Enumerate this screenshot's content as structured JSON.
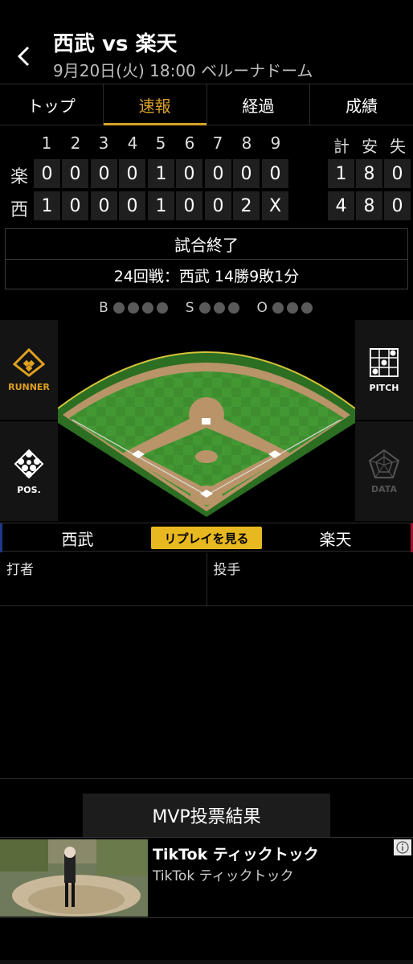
{
  "header": {
    "title": "西武 vs 楽天",
    "subtitle": "9月20日(火) 18:00 ベルーナドーム"
  },
  "tabs": [
    {
      "label": "トップ"
    },
    {
      "label": "速報",
      "active": true
    },
    {
      "label": "経過"
    },
    {
      "label": "成績"
    }
  ],
  "scoreboard": {
    "innings": [
      "1",
      "2",
      "3",
      "4",
      "5",
      "6",
      "7",
      "8",
      "9"
    ],
    "totals_headers": [
      "計",
      "安",
      "失"
    ],
    "rows": [
      {
        "team": "楽",
        "scores": [
          "0",
          "0",
          "0",
          "0",
          "1",
          "0",
          "0",
          "0",
          "0"
        ],
        "totals": [
          "1",
          "8",
          "0"
        ]
      },
      {
        "team": "西",
        "scores": [
          "1",
          "0",
          "0",
          "0",
          "1",
          "0",
          "0",
          "2",
          "X"
        ],
        "totals": [
          "4",
          "8",
          "0"
        ]
      }
    ]
  },
  "status": {
    "state": "試合終了",
    "record": "24回戦：西武 14勝9敗1分"
  },
  "bso": {
    "b_label": "B",
    "s_label": "S",
    "o_label": "O",
    "balls": 0,
    "strikes": 0,
    "outs": 0
  },
  "field_buttons": {
    "runner": "RUNNER",
    "pitch": "PITCH",
    "pos": "POS.",
    "data": "DATA"
  },
  "colors": {
    "accent": "#d8a12a",
    "replay_bg": "#e8b820",
    "home_bar": "#1a3a8a",
    "away_bar": "#a01030",
    "grass": "#3d8c2f",
    "dirt": "#b89468"
  },
  "matchup": {
    "left_team": "西武",
    "right_team": "楽天",
    "replay_label": "リプレイを見る",
    "batter_label": "打者",
    "pitcher_label": "投手"
  },
  "mvp": {
    "label": "MVP投票結果"
  },
  "ad": {
    "title": "TikTok ティックトック",
    "subtitle": "TikTok ティックトック",
    "info_icon": "info-icon"
  }
}
